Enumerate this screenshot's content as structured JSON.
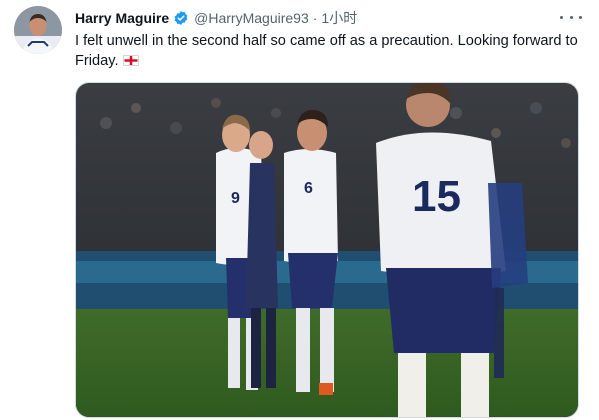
{
  "tweet": {
    "author_name": "Harry Maguire",
    "handle": "@HarryMaguire93",
    "separator": "·",
    "time": "1小时",
    "text": "I felt unwell in the second half so came off as a precaution. Looking forward to Friday.",
    "flag_icon": "england-flag-icon",
    "verified_icon": "verified-badge-icon",
    "more_icon": "more-options-icon"
  },
  "photo": {
    "player_numbers": [
      "9",
      "6",
      "15"
    ]
  },
  "colors": {
    "verified": "#1d9bf0",
    "text": "#0f1419",
    "muted": "#536471"
  }
}
